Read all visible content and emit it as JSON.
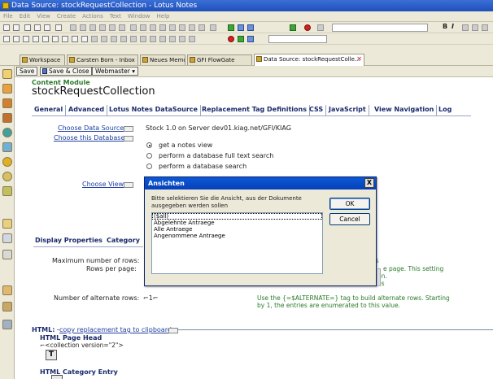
{
  "window": {
    "title": "Data Source: stockRequestCollection - Lotus Notes"
  },
  "menu": [
    "File",
    "Edit",
    "View",
    "Create",
    "Actions",
    "Text",
    "Window",
    "Help"
  ],
  "tabs": [
    {
      "label": "Workspace"
    },
    {
      "label": "Carsten Born - Inbox"
    },
    {
      "label": "Neues Memo"
    },
    {
      "label": "GFI FlowGate"
    },
    {
      "label": "Data Source: stockRequestColle..."
    }
  ],
  "actions": {
    "save": "Save",
    "save_close": "Save & Close",
    "webmaster": "Webmaster"
  },
  "format": {
    "bold": "B",
    "italic": "I"
  },
  "document": {
    "module_label": "Content Module",
    "title": "stockRequestCollection",
    "property_tabs": [
      "General",
      "Advanced",
      "Lotus Notes DataSource",
      "Replacement Tag Definitions",
      "CSS",
      "JavaScript",
      "View Navigation",
      "Log"
    ],
    "choose_data_source": "Choose Data Source",
    "choose_this_database": "Choose this Database",
    "data_source_value": "Stock 1.0 on Server dev01.kiag.net/GFI/KIAG",
    "radio_options": [
      "get a notes view",
      "perform a database full text search",
      "perform a database search"
    ],
    "choose_view": "Choose View",
    "display_tabs": [
      "Display Properties",
      "Category"
    ],
    "max_rows_label": "Maximum number of rows:",
    "rows_per_page_label": "Rows per page:",
    "alt_rows_label": "Number of alternate rows:",
    "alt_rows_value": "1",
    "help_es": "es",
    "help_page": "e page. This setting",
    "help_on": "on.",
    "help_es2": "es",
    "alt_rows_help_1": "Use the {=$ALTERNATE=} tag to build alternate rows. Starting",
    "alt_rows_help_2": "by 1, the entries are enumerated to this value.",
    "html_label": "HTML:",
    "copy_tag_link": "copy replacement tag to clipboard",
    "html_page_head": "HTML Page Head",
    "collection_tag": "<collection version=\"2\">",
    "text_button": "T",
    "html_category_entry": "HTML Category Entry"
  },
  "dialog": {
    "title": "Ansichten",
    "close": "X",
    "prompt": "Bitte selektieren Sie die Ansicht, aus der Dokumente ausgegeben werden sollen",
    "items": [
      "($all)",
      "Abgelehnte Antraege",
      "Alle Antraege",
      "Angenommene Antraege"
    ],
    "ok": "OK",
    "cancel": "Cancel"
  }
}
